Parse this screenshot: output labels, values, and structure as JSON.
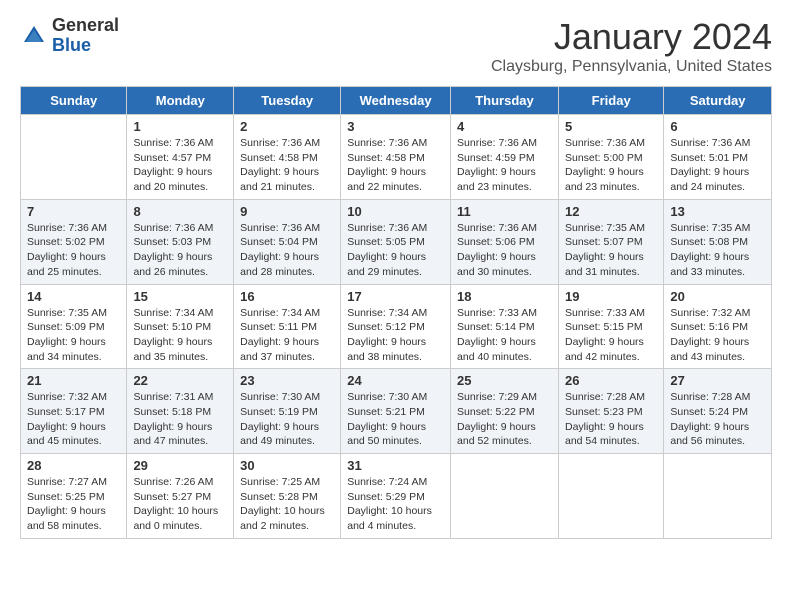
{
  "header": {
    "logo_general": "General",
    "logo_blue": "Blue",
    "month_title": "January 2024",
    "location": "Claysburg, Pennsylvania, United States"
  },
  "days_of_week": [
    "Sunday",
    "Monday",
    "Tuesday",
    "Wednesday",
    "Thursday",
    "Friday",
    "Saturday"
  ],
  "weeks": [
    [
      {
        "day": "",
        "sunrise": "",
        "sunset": "",
        "daylight": ""
      },
      {
        "day": "1",
        "sunrise": "Sunrise: 7:36 AM",
        "sunset": "Sunset: 4:57 PM",
        "daylight": "Daylight: 9 hours and 20 minutes."
      },
      {
        "day": "2",
        "sunrise": "Sunrise: 7:36 AM",
        "sunset": "Sunset: 4:58 PM",
        "daylight": "Daylight: 9 hours and 21 minutes."
      },
      {
        "day": "3",
        "sunrise": "Sunrise: 7:36 AM",
        "sunset": "Sunset: 4:58 PM",
        "daylight": "Daylight: 9 hours and 22 minutes."
      },
      {
        "day": "4",
        "sunrise": "Sunrise: 7:36 AM",
        "sunset": "Sunset: 4:59 PM",
        "daylight": "Daylight: 9 hours and 23 minutes."
      },
      {
        "day": "5",
        "sunrise": "Sunrise: 7:36 AM",
        "sunset": "Sunset: 5:00 PM",
        "daylight": "Daylight: 9 hours and 23 minutes."
      },
      {
        "day": "6",
        "sunrise": "Sunrise: 7:36 AM",
        "sunset": "Sunset: 5:01 PM",
        "daylight": "Daylight: 9 hours and 24 minutes."
      }
    ],
    [
      {
        "day": "7",
        "sunrise": "Sunrise: 7:36 AM",
        "sunset": "Sunset: 5:02 PM",
        "daylight": "Daylight: 9 hours and 25 minutes."
      },
      {
        "day": "8",
        "sunrise": "Sunrise: 7:36 AM",
        "sunset": "Sunset: 5:03 PM",
        "daylight": "Daylight: 9 hours and 26 minutes."
      },
      {
        "day": "9",
        "sunrise": "Sunrise: 7:36 AM",
        "sunset": "Sunset: 5:04 PM",
        "daylight": "Daylight: 9 hours and 28 minutes."
      },
      {
        "day": "10",
        "sunrise": "Sunrise: 7:36 AM",
        "sunset": "Sunset: 5:05 PM",
        "daylight": "Daylight: 9 hours and 29 minutes."
      },
      {
        "day": "11",
        "sunrise": "Sunrise: 7:36 AM",
        "sunset": "Sunset: 5:06 PM",
        "daylight": "Daylight: 9 hours and 30 minutes."
      },
      {
        "day": "12",
        "sunrise": "Sunrise: 7:35 AM",
        "sunset": "Sunset: 5:07 PM",
        "daylight": "Daylight: 9 hours and 31 minutes."
      },
      {
        "day": "13",
        "sunrise": "Sunrise: 7:35 AM",
        "sunset": "Sunset: 5:08 PM",
        "daylight": "Daylight: 9 hours and 33 minutes."
      }
    ],
    [
      {
        "day": "14",
        "sunrise": "Sunrise: 7:35 AM",
        "sunset": "Sunset: 5:09 PM",
        "daylight": "Daylight: 9 hours and 34 minutes."
      },
      {
        "day": "15",
        "sunrise": "Sunrise: 7:34 AM",
        "sunset": "Sunset: 5:10 PM",
        "daylight": "Daylight: 9 hours and 35 minutes."
      },
      {
        "day": "16",
        "sunrise": "Sunrise: 7:34 AM",
        "sunset": "Sunset: 5:11 PM",
        "daylight": "Daylight: 9 hours and 37 minutes."
      },
      {
        "day": "17",
        "sunrise": "Sunrise: 7:34 AM",
        "sunset": "Sunset: 5:12 PM",
        "daylight": "Daylight: 9 hours and 38 minutes."
      },
      {
        "day": "18",
        "sunrise": "Sunrise: 7:33 AM",
        "sunset": "Sunset: 5:14 PM",
        "daylight": "Daylight: 9 hours and 40 minutes."
      },
      {
        "day": "19",
        "sunrise": "Sunrise: 7:33 AM",
        "sunset": "Sunset: 5:15 PM",
        "daylight": "Daylight: 9 hours and 42 minutes."
      },
      {
        "day": "20",
        "sunrise": "Sunrise: 7:32 AM",
        "sunset": "Sunset: 5:16 PM",
        "daylight": "Daylight: 9 hours and 43 minutes."
      }
    ],
    [
      {
        "day": "21",
        "sunrise": "Sunrise: 7:32 AM",
        "sunset": "Sunset: 5:17 PM",
        "daylight": "Daylight: 9 hours and 45 minutes."
      },
      {
        "day": "22",
        "sunrise": "Sunrise: 7:31 AM",
        "sunset": "Sunset: 5:18 PM",
        "daylight": "Daylight: 9 hours and 47 minutes."
      },
      {
        "day": "23",
        "sunrise": "Sunrise: 7:30 AM",
        "sunset": "Sunset: 5:19 PM",
        "daylight": "Daylight: 9 hours and 49 minutes."
      },
      {
        "day": "24",
        "sunrise": "Sunrise: 7:30 AM",
        "sunset": "Sunset: 5:21 PM",
        "daylight": "Daylight: 9 hours and 50 minutes."
      },
      {
        "day": "25",
        "sunrise": "Sunrise: 7:29 AM",
        "sunset": "Sunset: 5:22 PM",
        "daylight": "Daylight: 9 hours and 52 minutes."
      },
      {
        "day": "26",
        "sunrise": "Sunrise: 7:28 AM",
        "sunset": "Sunset: 5:23 PM",
        "daylight": "Daylight: 9 hours and 54 minutes."
      },
      {
        "day": "27",
        "sunrise": "Sunrise: 7:28 AM",
        "sunset": "Sunset: 5:24 PM",
        "daylight": "Daylight: 9 hours and 56 minutes."
      }
    ],
    [
      {
        "day": "28",
        "sunrise": "Sunrise: 7:27 AM",
        "sunset": "Sunset: 5:25 PM",
        "daylight": "Daylight: 9 hours and 58 minutes."
      },
      {
        "day": "29",
        "sunrise": "Sunrise: 7:26 AM",
        "sunset": "Sunset: 5:27 PM",
        "daylight": "Daylight: 10 hours and 0 minutes."
      },
      {
        "day": "30",
        "sunrise": "Sunrise: 7:25 AM",
        "sunset": "Sunset: 5:28 PM",
        "daylight": "Daylight: 10 hours and 2 minutes."
      },
      {
        "day": "31",
        "sunrise": "Sunrise: 7:24 AM",
        "sunset": "Sunset: 5:29 PM",
        "daylight": "Daylight: 10 hours and 4 minutes."
      },
      {
        "day": "",
        "sunrise": "",
        "sunset": "",
        "daylight": ""
      },
      {
        "day": "",
        "sunrise": "",
        "sunset": "",
        "daylight": ""
      },
      {
        "day": "",
        "sunrise": "",
        "sunset": "",
        "daylight": ""
      }
    ]
  ]
}
